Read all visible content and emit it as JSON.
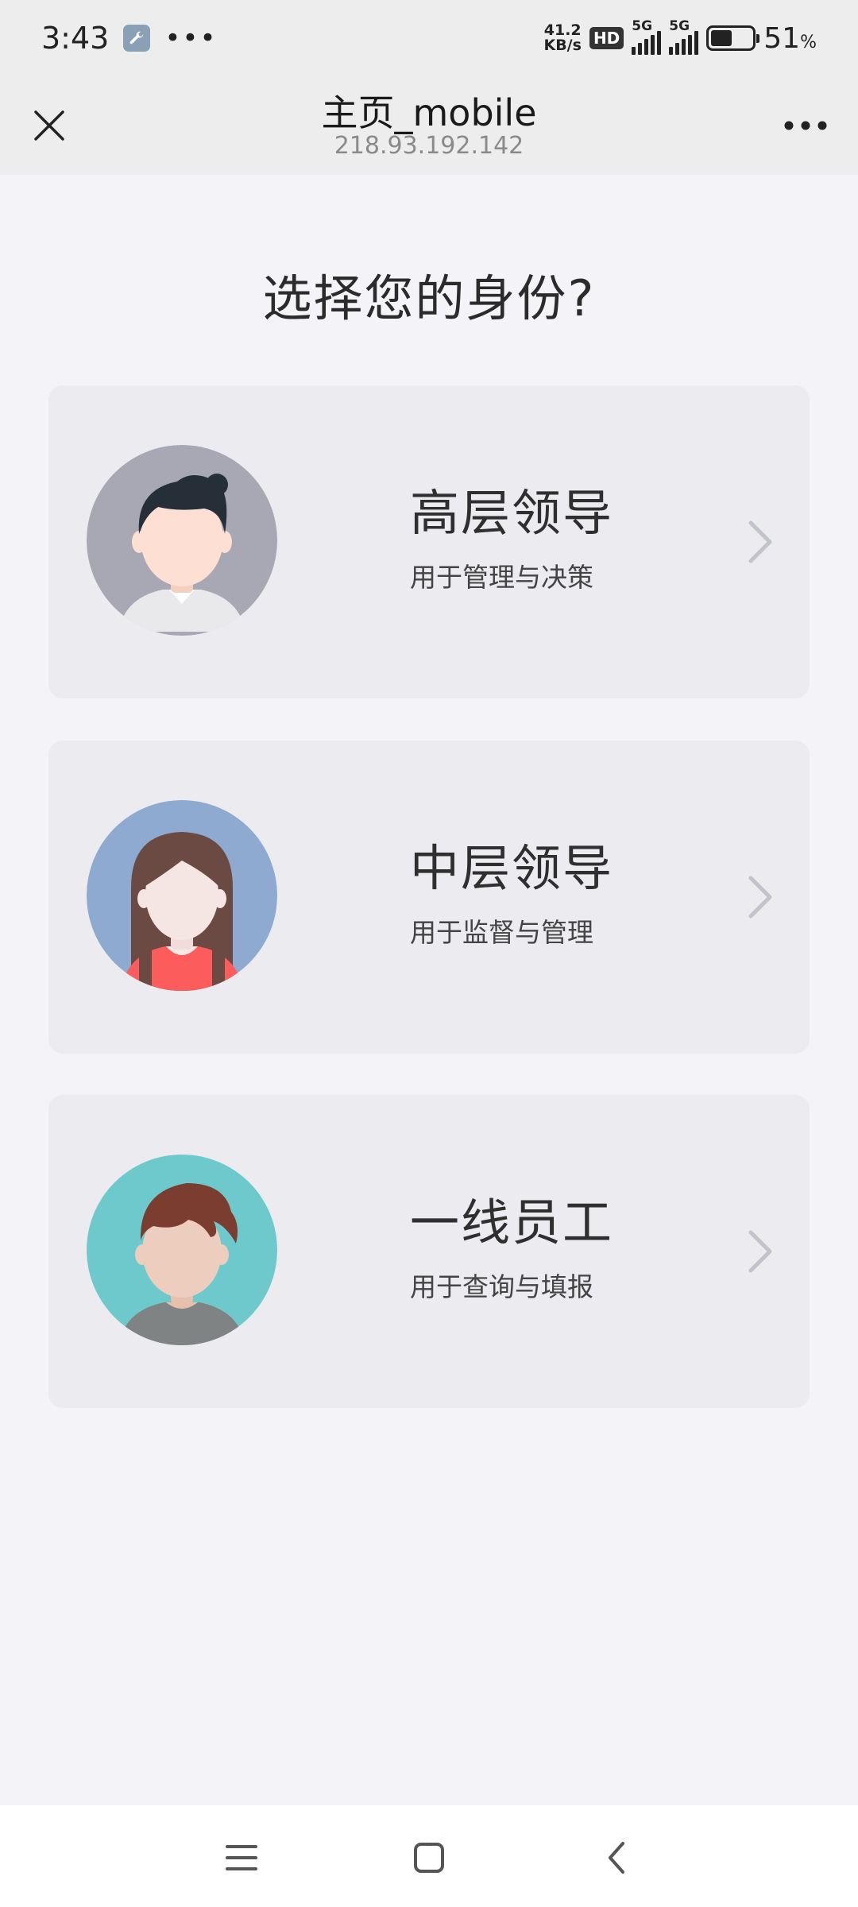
{
  "status_bar": {
    "time": "3:43",
    "net_speed_value": "41.2",
    "net_speed_unit": "KB/s",
    "hd_label": "HD",
    "signal1_label": "5G",
    "signal2_label": "5G",
    "battery_value": "51",
    "battery_unit": "%",
    "battery_level": 0.51
  },
  "header": {
    "title": "主页_mobile",
    "subtitle": "218.93.192.142"
  },
  "page": {
    "heading": "选择您的身份?"
  },
  "roles": [
    {
      "title": "高层领导",
      "description": "用于管理与决策",
      "avatar_bg": "#a7a8b4",
      "icon": "male-manager-avatar-icon"
    },
    {
      "title": "中层领导",
      "description": "用于监督与管理",
      "avatar_bg": "#8eaad0",
      "icon": "female-manager-avatar-icon"
    },
    {
      "title": "一线员工",
      "description": "用于查询与填报",
      "avatar_bg": "#6ec9cc",
      "icon": "employee-avatar-icon"
    }
  ],
  "nav": {
    "menu_icon": "menu-icon",
    "home_icon": "home-square-icon",
    "back_icon": "back-chevron-icon"
  }
}
